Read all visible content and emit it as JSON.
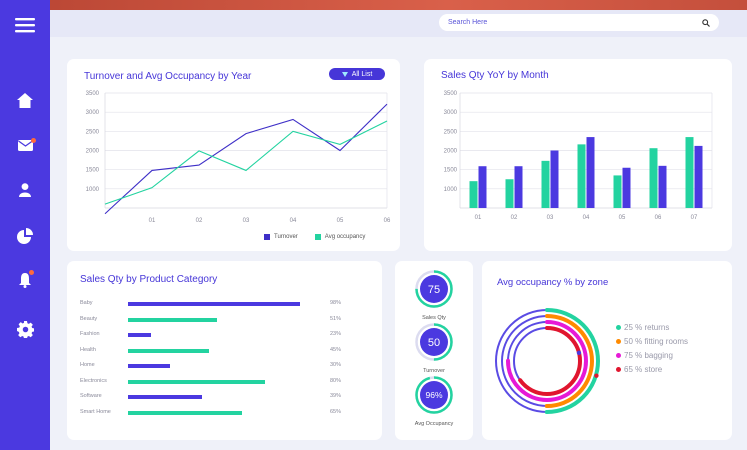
{
  "search": {
    "placeholder": "Search Here"
  },
  "sidebar": {
    "items": [
      "home",
      "mail",
      "user",
      "pie-chart",
      "bell",
      "settings"
    ]
  },
  "turnover_card": {
    "title": "Turnover and Avg Occupancy by Year",
    "filter": "All List",
    "legend": [
      "Turnover",
      "Avg occupancy"
    ]
  },
  "sales_yoy_card": {
    "title": "Sales Qty YoY by Month"
  },
  "category_card": {
    "title": "Sales Qty by Product Category",
    "rows": [
      {
        "label": "Baby",
        "pct": "98%",
        "value": 98,
        "color": "#4b39e0"
      },
      {
        "label": "Beauty",
        "pct": "51%",
        "value": 51,
        "color": "#23d3a0"
      },
      {
        "label": "Fashion",
        "pct": "23%",
        "value": 13,
        "color": "#4b39e0"
      },
      {
        "label": "Health",
        "pct": "45%",
        "value": 46,
        "color": "#23d3a0"
      },
      {
        "label": "Home",
        "pct": "30%",
        "value": 24,
        "color": "#4b39e0"
      },
      {
        "label": "Electronics",
        "pct": "80%",
        "value": 78,
        "color": "#23d3a0"
      },
      {
        "label": "Software",
        "pct": "39%",
        "value": 42,
        "color": "#4b39e0"
      },
      {
        "label": "Smart Home",
        "pct": "65%",
        "value": 65,
        "color": "#23d3a0"
      }
    ]
  },
  "gauges": [
    {
      "value": "75",
      "label": "Sales Qty",
      "fraction": 0.75
    },
    {
      "value": "50",
      "label": "Turnover",
      "fraction": 0.5
    },
    {
      "value": "96%",
      "label": "Avg Occupancy",
      "fraction": 0.96
    }
  ],
  "zone_card": {
    "title": "Avg occupancy % by zone",
    "zones": [
      {
        "label": "25 % returns",
        "value": 25,
        "color": "#23d3a0"
      },
      {
        "label": "50 % fitting rooms",
        "value": 50,
        "color": "#ff8a00"
      },
      {
        "label": "75 % bagging",
        "value": 75,
        "color": "#e61ad6"
      },
      {
        "label": "65 % store",
        "value": 65,
        "color": "#e0162f"
      }
    ]
  },
  "colors": {
    "accent": "#4b39e0",
    "teal": "#23d3a0",
    "sidebar": "#4b39e0"
  },
  "chart_data": [
    {
      "type": "line",
      "title": "Turnover and Avg Occupancy by Year",
      "x": [
        "",
        "01",
        "02",
        "03",
        "04",
        "05",
        "06"
      ],
      "series": [
        {
          "name": "Turnover",
          "values": [
            350,
            1480,
            1620,
            2440,
            2810,
            2000,
            3210
          ],
          "color": "#3e2fc7"
        },
        {
          "name": "Avg occupancy",
          "values": [
            600,
            1030,
            1990,
            1480,
            2500,
            2160,
            2770
          ],
          "color": "#23d3a0"
        }
      ],
      "yticks": [
        1000,
        1500,
        2000,
        2500,
        3000,
        3500
      ],
      "ylim": [
        500,
        3500
      ],
      "grid": true
    },
    {
      "type": "bar",
      "title": "Sales Qty YoY by Month",
      "categories": [
        "01",
        "02",
        "03",
        "04",
        "05",
        "06",
        "07"
      ],
      "series": [
        {
          "values": [
            1200,
            1250,
            1730,
            2160,
            1350,
            2060,
            2350
          ],
          "color": "#23d3a0"
        },
        {
          "values": [
            1590,
            1590,
            2000,
            2350,
            1550,
            1600,
            2120
          ],
          "color": "#4b39e0"
        }
      ],
      "yticks": [
        1000,
        1500,
        2000,
        2500,
        3000,
        3500
      ],
      "ylim": [
        500,
        3500
      ],
      "grid": true
    }
  ]
}
